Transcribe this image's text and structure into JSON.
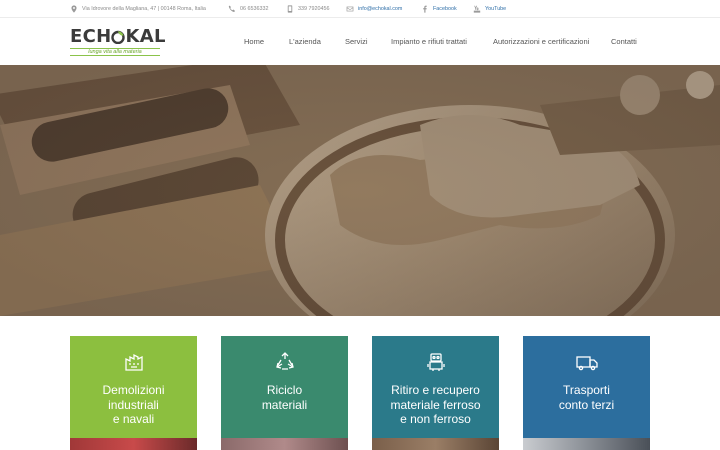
{
  "topbar": {
    "address": "Via Idrovore della Magliana, 47 | 00148 Roma, Italia",
    "phone1": "06 6536332",
    "phone2": "339 7920456",
    "email": "info@echokal.com",
    "facebook": "Facebook",
    "youtube": "YouTube"
  },
  "logo": {
    "word_left": "ECH",
    "word_right": "KAL",
    "tagline": "lunga vita alla materia"
  },
  "nav": {
    "items": [
      "Home",
      "L'azienda",
      "Servizi",
      "Impianto e rifiuti trattati",
      "Autorizzazioni e certificazioni",
      "Contatti"
    ]
  },
  "cards": [
    {
      "title": "Demolizioni\nindustriali\ne navali",
      "icon": "factory-icon",
      "color": "#8cbf3f"
    },
    {
      "title": "Riciclo\nmateriali",
      "icon": "recycle-icon",
      "color": "#3a8a6e"
    },
    {
      "title": "Ritiro e recupero\nmateriale ferroso\ne non ferroso",
      "icon": "robot-icon",
      "color": "#2b7a8a"
    },
    {
      "title": "Trasporti\nconto terzi",
      "icon": "truck-icon",
      "color": "#2c6e9e"
    }
  ],
  "colors": {
    "brand_green": "#8bc34a",
    "link_blue": "#2f6fa8"
  }
}
